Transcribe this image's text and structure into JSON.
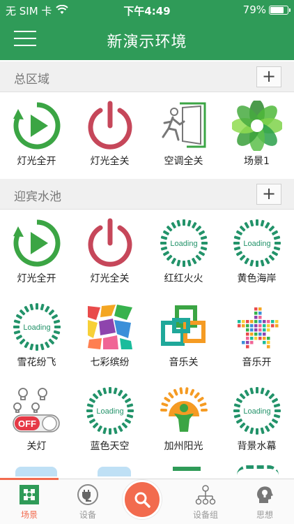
{
  "status_bar": {
    "carrier": "无 SIM 卡",
    "time": "下午4:49",
    "battery": "79%",
    "battery_level": 0.79
  },
  "nav": {
    "title": "新演示环境"
  },
  "sections": [
    {
      "name": "总区域",
      "add_label": "+",
      "items": [
        {
          "label": "灯光全开",
          "icon": "play-circle-icon"
        },
        {
          "label": "灯光全关",
          "icon": "power-icon"
        },
        {
          "label": "空调全关",
          "icon": "exit-door-icon"
        },
        {
          "label": "场景1",
          "icon": "green-flower-icon"
        }
      ]
    },
    {
      "name": "迎宾水池",
      "add_label": "+",
      "items": [
        {
          "label": "灯光全开",
          "icon": "play-circle-icon"
        },
        {
          "label": "灯光全关",
          "icon": "power-icon"
        },
        {
          "label": "红红火火",
          "icon": "loading-icon"
        },
        {
          "label": "黄色海岸",
          "icon": "loading-icon"
        },
        {
          "label": "雪花纷飞",
          "icon": "loading-icon"
        },
        {
          "label": "七彩缤纷",
          "icon": "colorful-shapes-icon"
        },
        {
          "label": "音乐关",
          "icon": "squares-icon"
        },
        {
          "label": "音乐开",
          "icon": "colorful-star-icon"
        },
        {
          "label": "关灯",
          "icon": "bulbs-off-icon"
        },
        {
          "label": "蓝色天空",
          "icon": "loading-icon"
        },
        {
          "label": "加州阳光",
          "icon": "sun-person-icon"
        },
        {
          "label": "背景水幕",
          "icon": "loading-icon"
        }
      ]
    }
  ],
  "loading_text": "Loading",
  "off_text": "OFF",
  "tabs": [
    {
      "label": "场景",
      "icon": "scene-icon",
      "active": true
    },
    {
      "label": "设备",
      "icon": "plug-icon",
      "active": false
    },
    {
      "label": "设备组",
      "icon": "device-group-icon",
      "active": false
    },
    {
      "label": "思想",
      "icon": "head-idea-icon",
      "active": false
    }
  ],
  "colors": {
    "brand_green": "#2f9b58",
    "accent_orange": "#f26b4e",
    "power_red": "#c6475a",
    "icon_green": "#3ba544",
    "loading_green": "#23936a"
  }
}
